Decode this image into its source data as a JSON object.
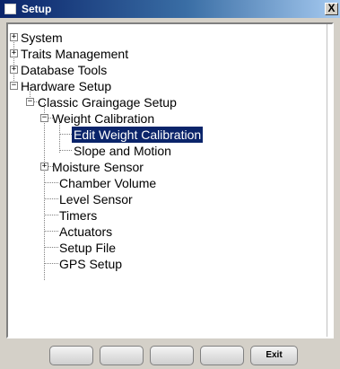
{
  "window": {
    "title": "Setup",
    "close_glyph": "X"
  },
  "tree": {
    "expander_collapsed": "+",
    "expander_expanded": "−",
    "nodes": [
      {
        "label": "System",
        "icon": "plus-expander",
        "selected": false
      },
      {
        "label": "Traits Management",
        "icon": "plus-expander",
        "selected": false
      },
      {
        "label": "Database Tools",
        "icon": "plus-expander",
        "selected": false
      },
      {
        "label": "Hardware Setup",
        "icon": "minus-expander",
        "selected": false
      },
      {
        "label": "Classic Graingage Setup",
        "icon": "minus-expander",
        "selected": false
      },
      {
        "label": "Weight Calibration",
        "icon": "minus-expander",
        "selected": false
      },
      {
        "label": "Edit Weight Calibration",
        "icon": "none",
        "selected": true
      },
      {
        "label": "Slope and Motion",
        "icon": "none",
        "selected": false
      },
      {
        "label": "Moisture Sensor",
        "icon": "plus-expander",
        "selected": false
      },
      {
        "label": "Chamber Volume",
        "icon": "none",
        "selected": false
      },
      {
        "label": "Level Sensor",
        "icon": "none",
        "selected": false
      },
      {
        "label": "Timers",
        "icon": "none",
        "selected": false
      },
      {
        "label": "Actuators",
        "icon": "none",
        "selected": false
      },
      {
        "label": "Setup File",
        "icon": "none",
        "selected": false
      },
      {
        "label": "GPS Setup",
        "icon": "none",
        "selected": false
      }
    ]
  },
  "buttons": {
    "items": [
      {
        "label": ""
      },
      {
        "label": ""
      },
      {
        "label": ""
      },
      {
        "label": ""
      },
      {
        "label": "Exit"
      }
    ]
  },
  "colors": {
    "selection": "#0a246a",
    "titlebar_start": "#0a246a",
    "titlebar_end": "#a6caf0",
    "chrome": "#d4d0c8"
  }
}
